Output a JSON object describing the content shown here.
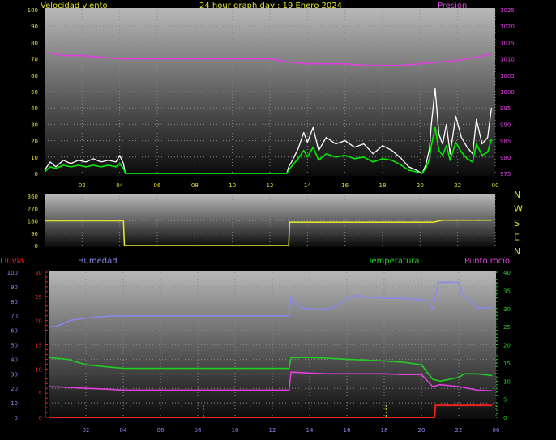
{
  "chart_data": [
    {
      "type": "line",
      "panel": "wind",
      "title": "24 hour graph day : 19 Enero 2024",
      "ylabel": "Velocidad viento",
      "ylabel_right": "Presión",
      "ylim": [
        0,
        100
      ],
      "ylim_right": [
        975,
        1025
      ],
      "yticks": [
        "0",
        "10",
        "20",
        "30",
        "40",
        "50",
        "60",
        "70",
        "80",
        "90",
        "100"
      ],
      "yticks_right": [
        "975",
        "980",
        "985",
        "990",
        "995",
        "1000",
        "1005",
        "1010",
        "1015",
        "1020",
        "1025"
      ],
      "xticks": [
        "02",
        "04",
        "06",
        "08",
        "10",
        "12",
        "14",
        "16",
        "18",
        "20",
        "22",
        "00"
      ],
      "series": [
        {
          "axis": "left",
          "color": "#ffffff",
          "x": [
            0,
            0.3,
            0.6,
            1,
            1.4,
            1.8,
            2.2,
            2.6,
            3,
            3.4,
            3.8,
            4.0,
            4.2,
            4.3,
            6,
            8,
            10,
            12,
            12.9,
            13.0,
            13.2,
            13.5,
            13.8,
            14.0,
            14.3,
            14.6,
            15,
            15.5,
            16,
            16.5,
            17,
            17.5,
            18,
            18.5,
            19,
            19.4,
            19.8,
            20.1,
            20.3,
            20.5,
            20.6,
            20.8,
            21.0,
            21.2,
            21.4,
            21.6,
            21.9,
            22.2,
            22.5,
            22.8,
            23.0,
            23.3,
            23.6,
            23.8
          ],
          "y": [
            2,
            7,
            4,
            8,
            6,
            8,
            7,
            9,
            7,
            8,
            7,
            11,
            6,
            0,
            0,
            0,
            0,
            0,
            0,
            4,
            8,
            15,
            25,
            19,
            28,
            14,
            22,
            18,
            20,
            16,
            18,
            12,
            17,
            14,
            9,
            4,
            2,
            0,
            5,
            15,
            30,
            52,
            24,
            18,
            30,
            12,
            35,
            22,
            16,
            12,
            33,
            18,
            22,
            40
          ]
        },
        {
          "axis": "left",
          "color": "#00ee00",
          "x": [
            0,
            0.3,
            0.6,
            1,
            1.4,
            1.8,
            2.2,
            2.6,
            3,
            3.4,
            3.8,
            4.0,
            4.2,
            4.3,
            6,
            8,
            10,
            12,
            12.9,
            13.0,
            13.2,
            13.5,
            13.8,
            14.0,
            14.3,
            14.6,
            15,
            15.5,
            16,
            16.5,
            17,
            17.5,
            18,
            18.5,
            19,
            19.4,
            19.8,
            20.1,
            20.3,
            20.5,
            20.6,
            20.8,
            21.0,
            21.2,
            21.4,
            21.6,
            21.9,
            22.2,
            22.5,
            22.8,
            23.0,
            23.3,
            23.6,
            23.8
          ],
          "y": [
            1,
            4,
            3,
            5,
            4,
            5,
            4,
            5,
            4,
            5,
            4,
            6,
            3,
            0,
            0,
            0,
            0,
            0,
            0,
            2,
            5,
            9,
            14,
            10,
            16,
            8,
            12,
            10,
            11,
            9,
            10,
            7,
            9,
            8,
            5,
            2,
            1,
            0,
            3,
            9,
            17,
            28,
            14,
            11,
            17,
            8,
            19,
            13,
            9,
            7,
            18,
            11,
            13,
            21
          ]
        },
        {
          "axis": "right",
          "color": "#e040e0",
          "x": [
            0,
            0.5,
            1,
            2,
            3,
            4,
            5,
            6,
            7,
            8,
            9,
            10,
            11,
            12,
            12.5,
            13,
            14,
            15,
            16,
            17,
            18,
            19,
            20,
            21,
            22,
            23,
            23.8
          ],
          "y": [
            1012,
            1011.5,
            1011,
            1011,
            1010.5,
            1010,
            1010,
            1010,
            1010,
            1010,
            1010,
            1010,
            1010,
            1010,
            1009.5,
            1009,
            1008.5,
            1008.5,
            1008.5,
            1008,
            1008,
            1008,
            1008.5,
            1009,
            1009.5,
            1010.5,
            1011.5
          ]
        }
      ]
    },
    {
      "type": "line",
      "panel": "direction",
      "ylim": [
        0,
        360
      ],
      "yticks": [
        "0",
        "90",
        "180",
        "270",
        "360"
      ],
      "right_labels": [
        "N",
        "W",
        "S",
        "E",
        "N"
      ],
      "series": [
        {
          "color": "#e0e030",
          "x": [
            0,
            4.2,
            4.25,
            13.0,
            13.05,
            20.7,
            21.2,
            23.8
          ],
          "y": [
            180,
            180,
            0,
            0,
            170,
            170,
            185,
            185
          ]
        }
      ]
    },
    {
      "type": "line",
      "panel": "temperature",
      "labels": {
        "rain": "Lluvia",
        "humidity": "Humedad",
        "temperature": "Temperatura",
        "dewpoint": "Punto rocío"
      },
      "ylim_humidity": [
        0,
        100
      ],
      "ylim_rain": [
        0,
        30
      ],
      "ylim_temp": [
        0,
        40
      ],
      "yticks_humidity": [
        "0",
        "10",
        "20",
        "30",
        "40",
        "50",
        "60",
        "70",
        "80",
        "90",
        "100"
      ],
      "yticks_rain": [
        "0",
        "5",
        "10",
        "15",
        "20",
        "25",
        "30"
      ],
      "yticks_temp": [
        "0",
        "5",
        "10",
        "15",
        "20",
        "25",
        "30",
        "35",
        "40"
      ],
      "xticks": [
        "02",
        "04",
        "06",
        "08",
        "10",
        "12",
        "14",
        "16",
        "18",
        "20",
        "22",
        "00"
      ],
      "series": [
        {
          "name": "Humedad",
          "axis": "humidity",
          "color": "#8888ee",
          "x": [
            0,
            0.5,
            1.2,
            1.8,
            2.5,
            3.5,
            4,
            5,
            6,
            7,
            8,
            9,
            10,
            11,
            12,
            12.9,
            13.0,
            13.3,
            13.6,
            14,
            14.5,
            15,
            15.5,
            16,
            16.5,
            17,
            18,
            19,
            20,
            20.4,
            20.6,
            20.9,
            21.5,
            22.0,
            22.2,
            22.6,
            23,
            23.8
          ],
          "y": [
            62,
            63,
            67,
            68,
            69,
            70,
            70,
            70,
            70,
            70,
            70,
            70,
            70,
            70,
            70,
            70,
            83,
            78,
            75,
            75,
            74,
            75,
            77,
            82,
            84,
            83,
            82,
            82,
            81,
            80,
            74,
            93,
            93,
            93,
            85,
            80,
            75,
            76
          ]
        },
        {
          "name": "Temperatura",
          "axis": "temp",
          "color": "#22cc22",
          "x": [
            0,
            1,
            2,
            3,
            4,
            6,
            8,
            10,
            12,
            12.9,
            13.0,
            14,
            15,
            16,
            17,
            18,
            19,
            20,
            20.6,
            21,
            22,
            22.3,
            23,
            23.8
          ],
          "y": [
            16.5,
            16,
            14.5,
            14,
            13.5,
            13.5,
            13.5,
            13.5,
            13.5,
            13.5,
            16.5,
            16.5,
            16.3,
            16,
            15.8,
            15.5,
            15.2,
            14.5,
            10.5,
            10.0,
            11,
            12,
            12,
            11.5
          ]
        },
        {
          "name": "Punto rocío",
          "axis": "temp",
          "color": "#e040e0",
          "x": [
            0,
            1,
            2,
            3,
            4,
            6,
            8,
            10,
            12,
            12.9,
            13.0,
            14,
            15,
            16,
            17,
            18,
            19,
            20,
            20.6,
            21,
            22,
            23,
            23.8
          ],
          "y": [
            8.5,
            8.3,
            8,
            7.8,
            7.5,
            7.5,
            7.5,
            7.5,
            7.5,
            7.5,
            12.5,
            12.2,
            12,
            12,
            12,
            12,
            11.8,
            11.8,
            8.5,
            9,
            8.5,
            7.5,
            7.3
          ]
        },
        {
          "name": "Lluvia",
          "axis": "rain",
          "color": "#ee2020",
          "x": [
            0,
            20.7,
            20.75,
            23.8
          ],
          "y": [
            0,
            0,
            2.5,
            2.5
          ]
        }
      ],
      "markers_x": [
        8.3,
        18.1
      ]
    }
  ]
}
